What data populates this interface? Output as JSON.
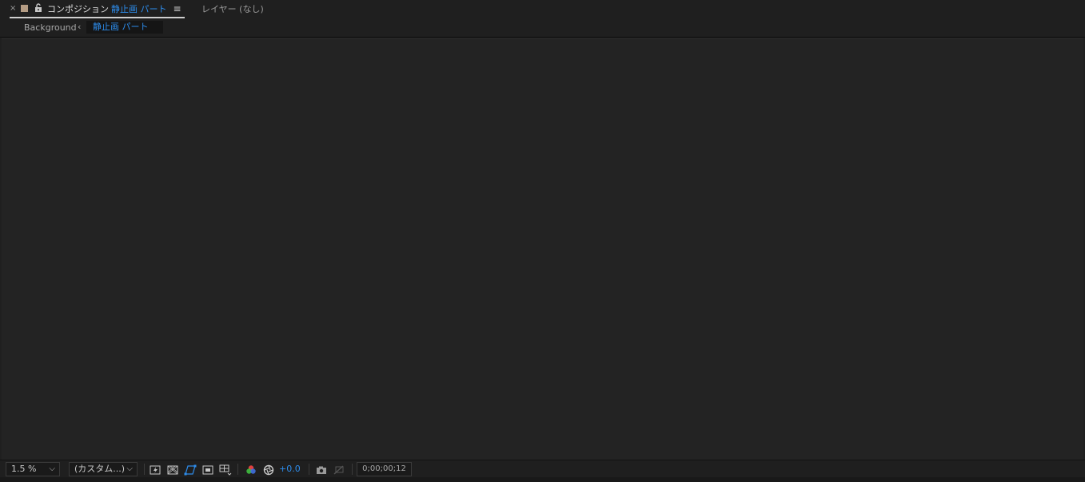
{
  "tabs": {
    "close_glyph": "×",
    "composition_label": "コンポジション",
    "composition_name": "静止画 パート",
    "menu_glyph": "≡",
    "layer_label": "レイヤー (なし)",
    "swatch_color": "#b49c84",
    "lock_icon": "lock-open-icon"
  },
  "breadcrumb": {
    "parent": "Background",
    "separator": "‹",
    "current": "静止画 パート"
  },
  "footer": {
    "zoom": "1.5 %",
    "resolution": "(カスタム...)",
    "exposure": "+0.0",
    "timecode": "0;00;00;12",
    "icons": [
      "fast-preview-icon",
      "transparency-grid-icon",
      "mask-path-icon",
      "region-of-interest-icon",
      "grid-guides-icon",
      "color-channel-icon",
      "reset-exposure-icon",
      "snapshot-icon",
      "show-snapshot-icon"
    ]
  },
  "colors": {
    "accent": "#2d8ceb",
    "panel": "#1f1f1f",
    "viewer": "#232323"
  }
}
